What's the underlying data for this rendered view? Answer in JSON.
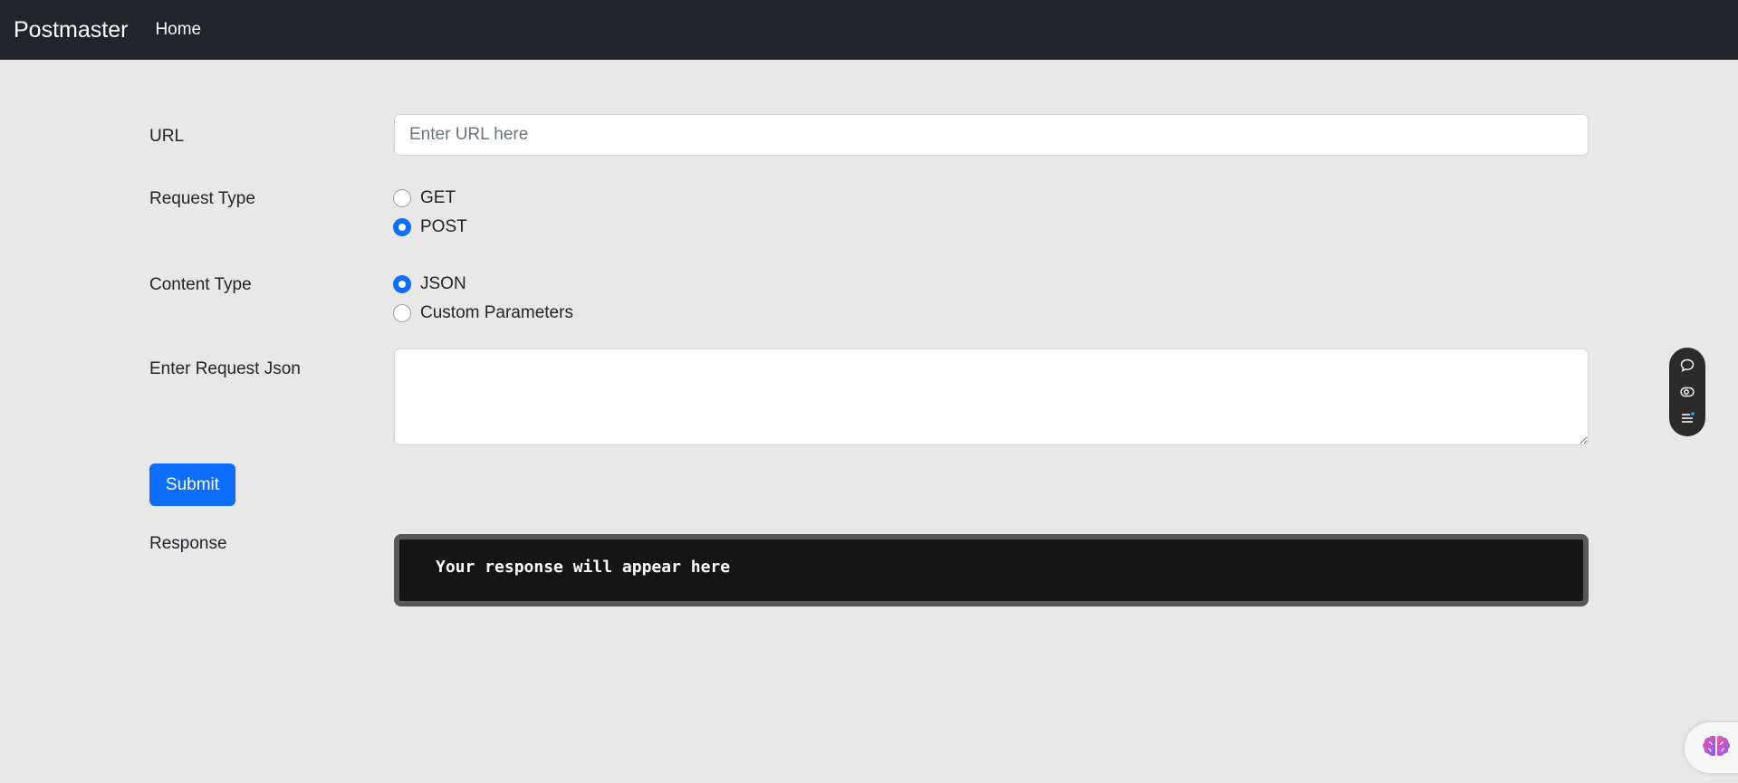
{
  "navbar": {
    "brand": "Postmaster",
    "links": [
      "Home"
    ]
  },
  "form": {
    "url_label": "URL",
    "url_placeholder": "Enter URL here",
    "url_value": "",
    "request_type_label": "Request Type",
    "request_types": [
      {
        "label": "GET",
        "checked": false
      },
      {
        "label": "POST",
        "checked": true
      }
    ],
    "content_type_label": "Content Type",
    "content_types": [
      {
        "label": "JSON",
        "checked": true
      },
      {
        "label": "Custom Parameters",
        "checked": false
      }
    ],
    "json_label": "Enter Request Json",
    "json_value": "",
    "submit_label": "Submit",
    "response_label": "Response",
    "response_text": "Your response will appear here"
  },
  "floating_toolbar": {
    "icons": [
      "chat-bubble-icon",
      "eye-toggle-icon",
      "list-menu-icon"
    ]
  },
  "assistant_widget": {
    "icon": "brain-icon"
  },
  "colors": {
    "navbar_bg": "#212529",
    "primary": "#0d6efd",
    "page_bg": "#e9e8e8",
    "response_bg": "#151515"
  }
}
